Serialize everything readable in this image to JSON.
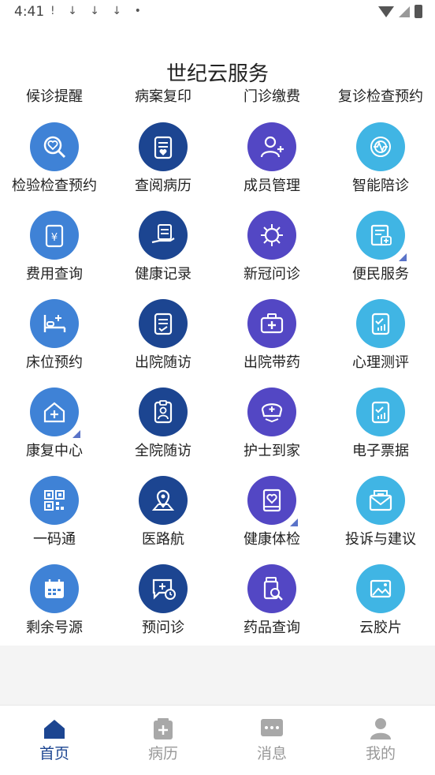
{
  "status_bar": {
    "time": "4:41",
    "notification_icons": "! ↓ ↓ ↓ •"
  },
  "page": {
    "title": "世纪云服务"
  },
  "top_links": [
    "候诊提醒",
    "病案复印",
    "门诊缴费",
    "复诊检查预约"
  ],
  "services": [
    {
      "label": "检验检查预约",
      "icon": "search-heart-icon",
      "color": "#3f82d6"
    },
    {
      "label": "查阅病历",
      "icon": "clipboard-heart-icon",
      "color": "#1c4591"
    },
    {
      "label": "成员管理",
      "icon": "add-user-icon",
      "color": "#5347c4"
    },
    {
      "label": "智能陪诊",
      "icon": "target-pulse-icon",
      "color": "#40b5e4"
    },
    {
      "label": "费用查询",
      "icon": "yuan-clipboard-icon",
      "color": "#3f82d6"
    },
    {
      "label": "健康记录",
      "icon": "hand-document-icon",
      "color": "#1c4591"
    },
    {
      "label": "新冠问诊",
      "icon": "virus-icon",
      "color": "#5347c4"
    },
    {
      "label": "便民服务",
      "icon": "document-plus-icon",
      "color": "#40b5e4"
    },
    {
      "label": "床位预约",
      "icon": "hospital-bed-icon",
      "color": "#3f82d6"
    },
    {
      "label": "出院随访",
      "icon": "checklist-icon",
      "color": "#1c4591"
    },
    {
      "label": "出院带药",
      "icon": "medicine-kit-icon",
      "color": "#5347c4"
    },
    {
      "label": "心理测评",
      "icon": "clipboard-chart-icon",
      "color": "#40b5e4"
    },
    {
      "label": "康复中心",
      "icon": "home-plus-icon",
      "color": "#3f82d6"
    },
    {
      "label": "全院随访",
      "icon": "clipboard-person-icon",
      "color": "#1c4591"
    },
    {
      "label": "护士到家",
      "icon": "nurse-cap-icon",
      "color": "#5347c4"
    },
    {
      "label": "电子票据",
      "icon": "clipboard-chart-icon",
      "color": "#40b5e4"
    },
    {
      "label": "一码通",
      "icon": "qr-code-icon",
      "color": "#3f82d6"
    },
    {
      "label": "医路航",
      "icon": "map-pin-icon",
      "color": "#1c4591"
    },
    {
      "label": "健康体检",
      "icon": "heart-book-icon",
      "color": "#5347c4"
    },
    {
      "label": "投诉与建议",
      "icon": "mail-icon",
      "color": "#40b5e4"
    },
    {
      "label": "剩余号源",
      "icon": "calendar-icon",
      "color": "#3f82d6"
    },
    {
      "label": "预问诊",
      "icon": "chat-clock-icon",
      "color": "#1c4591"
    },
    {
      "label": "药品查询",
      "icon": "pill-search-icon",
      "color": "#5347c4"
    },
    {
      "label": "云胶片",
      "icon": "image-icon",
      "color": "#40b5e4"
    }
  ],
  "bottom_nav": [
    {
      "label": "首页",
      "icon": "home-icon",
      "active": true
    },
    {
      "label": "病历",
      "icon": "medical-record-icon",
      "active": false
    },
    {
      "label": "消息",
      "icon": "message-icon",
      "active": false
    },
    {
      "label": "我的",
      "icon": "user-icon",
      "active": false
    }
  ]
}
